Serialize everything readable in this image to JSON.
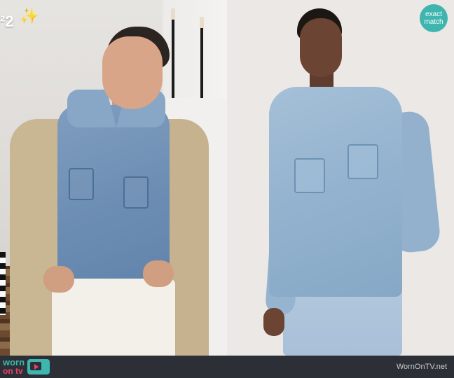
{
  "header": {
    "story_fragment": "²2",
    "sparkles_icon": "sparkles-icon"
  },
  "badge": {
    "line1": "exact",
    "line2": "match",
    "color": "#3fb5b0"
  },
  "footer": {
    "logo_line1": "worn",
    "logo_line2": "on tv",
    "logo_icon": "tv-icon",
    "site": "WornOnTV.net",
    "bg_color": "#2c3036",
    "accent": "#3fb5b0",
    "accent2": "#e8456b"
  }
}
